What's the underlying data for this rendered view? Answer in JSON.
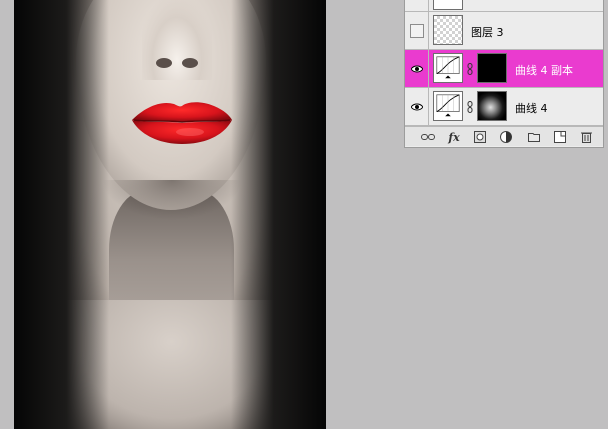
{
  "document": {
    "photo_subject": ""
  },
  "layers_panel": {
    "layers": [
      {
        "name": "",
        "visible": false,
        "thumbnail": "white",
        "partial": true
      },
      {
        "name": "图层 3",
        "visible": false,
        "thumbnail": "transparent-checker"
      },
      {
        "name": "曲线 4 副本",
        "visible": true,
        "thumbnail": "curves-adjustment",
        "mask": "black",
        "selected": true
      },
      {
        "name": "曲线 4",
        "visible": true,
        "thumbnail": "curves-adjustment",
        "mask": "face-mask"
      }
    ],
    "toolbar": [
      {
        "icon": "link-layers-icon",
        "glyph": "⛓"
      },
      {
        "icon": "layer-style-icon",
        "glyph": "fx"
      },
      {
        "icon": "add-mask-icon",
        "glyph": "◙"
      },
      {
        "icon": "adjustment-layer-icon",
        "glyph": "◐"
      },
      {
        "icon": "new-group-icon",
        "glyph": "▭"
      },
      {
        "icon": "new-layer-icon",
        "glyph": "▢"
      },
      {
        "icon": "delete-layer-icon",
        "glyph": "🗑"
      }
    ]
  },
  "colors": {
    "selected_layer": "#ea3bcf",
    "lip_red": "#d8141c",
    "background_gray": "#c0bfc0"
  }
}
